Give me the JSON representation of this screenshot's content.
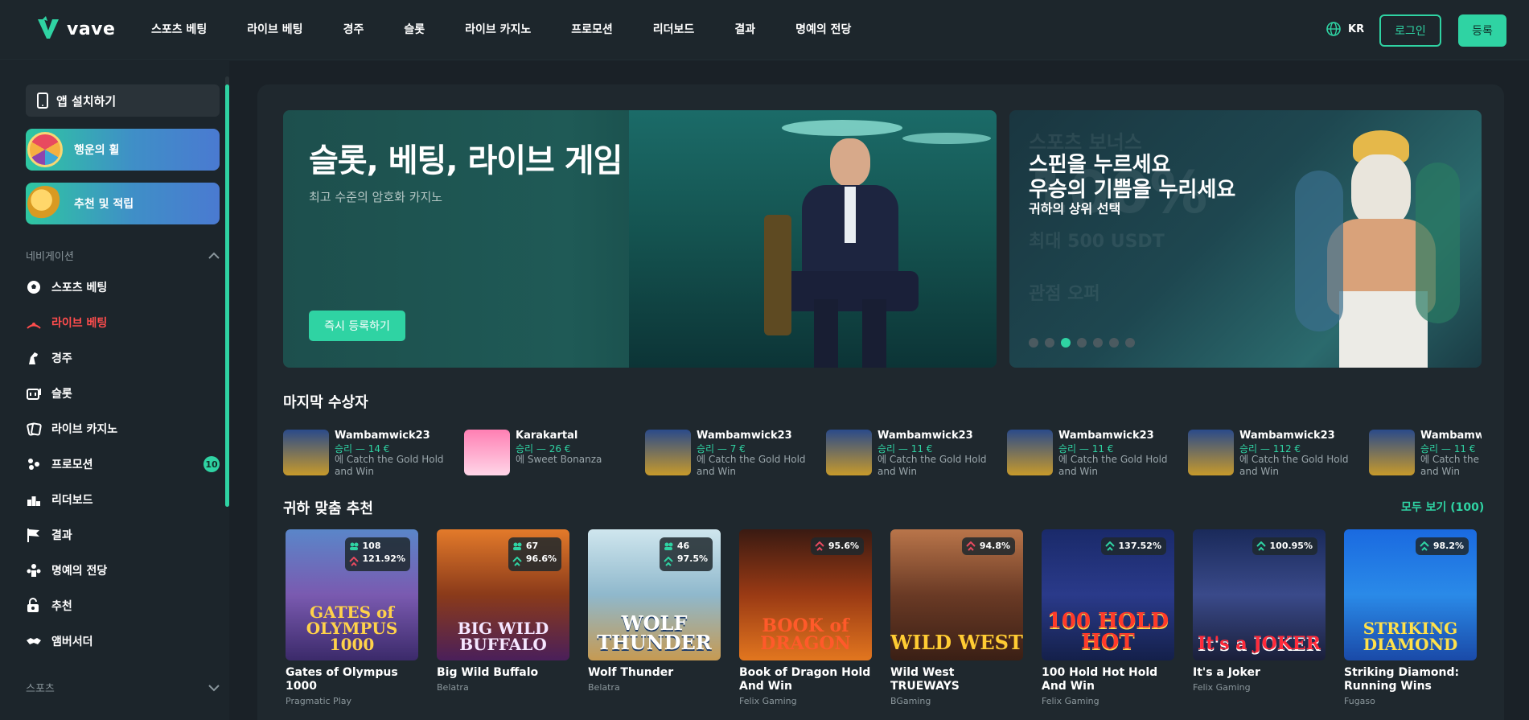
{
  "header": {
    "logo_text": "vave",
    "nav": [
      "스포츠 베팅",
      "라이브 베팅",
      "경주",
      "슬롯",
      "라이브 카지노",
      "프로모션",
      "리더보드",
      "결과",
      "명예의 전당"
    ],
    "lang": "KR",
    "login": "로그인",
    "register": "등록"
  },
  "sidebar": {
    "app_install": "앱 설치하기",
    "promo1": "행운의 휠",
    "promo2": "추천 및 적립",
    "nav_section": "네비게이션",
    "items": [
      {
        "label": "스포츠 베팅",
        "icon": "soccer-ball-icon"
      },
      {
        "label": "라이브 베팅",
        "icon": "live-signal-icon"
      },
      {
        "label": "경주",
        "icon": "horse-icon"
      },
      {
        "label": "슬롯",
        "icon": "slot-machine-icon"
      },
      {
        "label": "라이브 카지노",
        "icon": "cards-icon"
      },
      {
        "label": "프로모션",
        "icon": "gift-icon",
        "badge": "10"
      },
      {
        "label": "리더보드",
        "icon": "podium-icon"
      },
      {
        "label": "결과",
        "icon": "flag-icon"
      },
      {
        "label": "명예의 전당",
        "icon": "trophy-people-icon"
      },
      {
        "label": "추천",
        "icon": "referral-icon"
      },
      {
        "label": "앰버서더",
        "icon": "handshake-icon"
      }
    ],
    "sports_section": "스포츠"
  },
  "hero": {
    "title": "슬롯, 베팅, 라이브 게임",
    "subtitle": "최고 수준의 암호화 카지노",
    "cta": "즉시 등록하기"
  },
  "hero2": {
    "line1": "스핀을 누르세요",
    "line2": "우승의 기쁨을 누리세요",
    "line3": "귀하의 상위 선택",
    "ghost1": "스포츠 보너스",
    "ghost2": "100%",
    "ghost3": "최대 500 USDT",
    "ghost4": "관점 오퍼",
    "active_slide": 3
  },
  "winners_title": "마지막 수상자",
  "winners": [
    {
      "name": "Wambamwick23",
      "amount": "승리 — 14 €",
      "game": "에 Catch the Gold Hold and Win"
    },
    {
      "name": "Karakartal",
      "amount": "승리 — 26 €",
      "game": "에 Sweet Bonanza"
    },
    {
      "name": "Wambamwick23",
      "amount": "승리 — 7 €",
      "game": "에 Catch the Gold Hold and Win"
    },
    {
      "name": "Wambamwick23",
      "amount": "승리 — 11 €",
      "game": "에 Catch the Gold Hold and Win"
    },
    {
      "name": "Wambamwick23",
      "amount": "승리 — 11 €",
      "game": "에 Catch the Gold Hold and Win"
    },
    {
      "name": "Wambamwick23",
      "amount": "승리 — 112 €",
      "game": "에 Catch the Gold Hold and Win"
    },
    {
      "name": "Wambamwi",
      "amount": "승리 — 11 €",
      "game": "에 Catch the and Win"
    }
  ],
  "recommend_title": "귀하 맞춤 추천",
  "see_all": "모두 보기 (100)",
  "games": [
    {
      "title": "Gates of Olympus 1000",
      "provider": "Pragmatic Play",
      "players": "108",
      "rtp": "121.92%",
      "art": "GATES of OLYMPUS 1000"
    },
    {
      "title": "Big Wild Buffalo",
      "provider": "Belatra",
      "players": "67",
      "rtp": "96.6%",
      "art": "BIG WILD BUFFALO"
    },
    {
      "title": "Wolf Thunder",
      "provider": "Belatra",
      "players": "46",
      "rtp": "97.5%",
      "art": "WOLF THUNDER"
    },
    {
      "title": "Book of Dragon Hold And Win",
      "provider": "Felix Gaming",
      "rtp": "95.6%",
      "art": "BOOK of DRAGON"
    },
    {
      "title": "Wild West TRUEWAYS",
      "provider": "BGaming",
      "rtp": "94.8%",
      "art": "WILD WEST"
    },
    {
      "title": "100 Hold Hot Hold And Win",
      "provider": "Felix Gaming",
      "rtp": "137.52%",
      "art": "100 HOLD HOT"
    },
    {
      "title": "It's a Joker",
      "provider": "Felix Gaming",
      "rtp": "100.95%",
      "art": "It's a JOKER"
    },
    {
      "title": "Striking Diamond: Running Wins",
      "provider": "Fugaso",
      "rtp": "98.2%",
      "art": "STRIKING DIAMOND"
    }
  ]
}
